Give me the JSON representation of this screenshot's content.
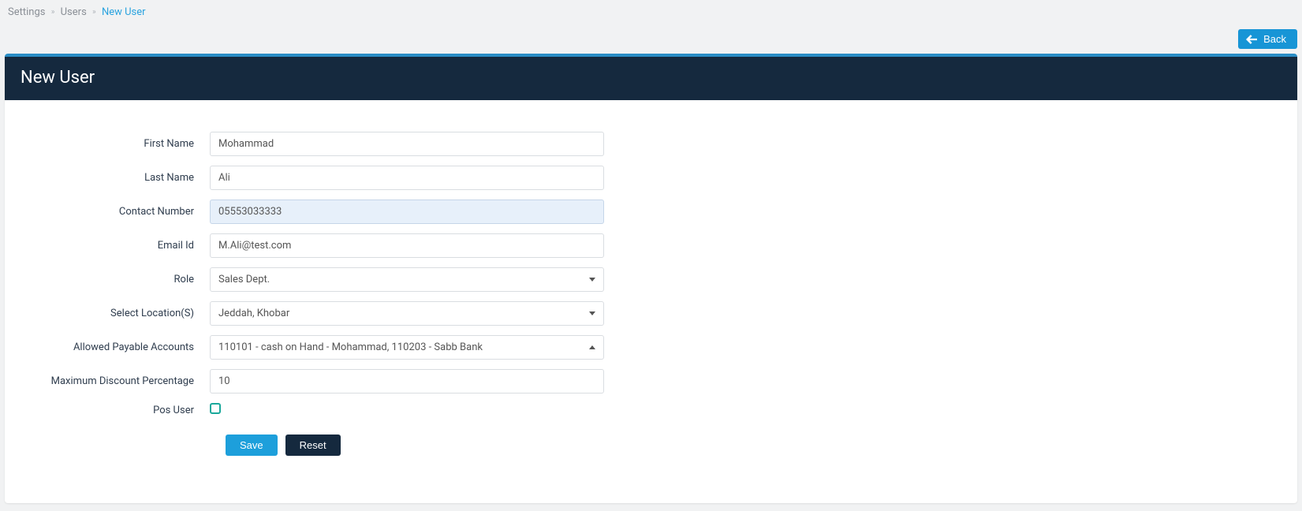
{
  "breadcrumb": {
    "item0": "Settings",
    "item1": "Users",
    "item2": "New User"
  },
  "back": {
    "label": "Back"
  },
  "panel": {
    "title": "New User"
  },
  "form": {
    "first_name": {
      "label": "First Name",
      "value": "Mohammad"
    },
    "last_name": {
      "label": "Last Name",
      "value": "Ali"
    },
    "contact_number": {
      "label": "Contact Number",
      "value": "05553033333"
    },
    "email": {
      "label": "Email Id",
      "value": "M.Ali@test.com"
    },
    "role": {
      "label": "Role",
      "value": "Sales Dept."
    },
    "locations": {
      "label": "Select Location(S)",
      "value": "Jeddah, Khobar"
    },
    "accounts": {
      "label": "Allowed Payable Accounts",
      "value": "110101 - cash on Hand - Mohammad, 110203 - Sabb Bank"
    },
    "max_discount": {
      "label": "Maximum Discount Percentage",
      "value": "10"
    },
    "pos_user": {
      "label": "Pos User"
    },
    "save_label": "Save",
    "reset_label": "Reset"
  }
}
